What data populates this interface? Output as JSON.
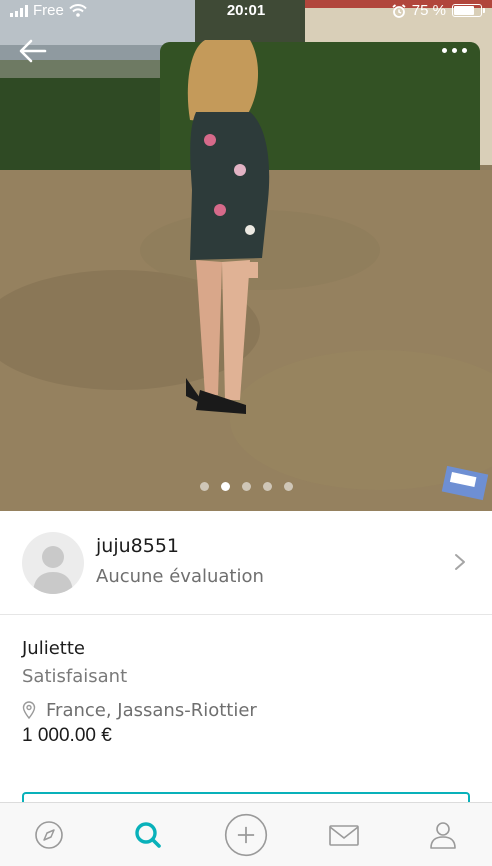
{
  "status_bar": {
    "carrier": "Free",
    "time": "20:01",
    "battery_text": "75 %",
    "battery_level": 0.75
  },
  "photo": {
    "current_index": 2,
    "count": 5
  },
  "seller": {
    "username": "juju8551",
    "rating_text": "Aucune évaluation"
  },
  "item": {
    "title": "Juliette",
    "condition": "Satisfaisant",
    "location": "France, Jassans-Riottier",
    "price": "1 000.00 €"
  },
  "tabs": [
    {
      "icon": "compass-icon"
    },
    {
      "icon": "search-icon",
      "active": true
    },
    {
      "icon": "plus-circle-icon"
    },
    {
      "icon": "mail-icon"
    },
    {
      "icon": "profile-icon"
    }
  ],
  "colors": {
    "accent": "#09b1ba",
    "icon_gray": "#9a9a9a"
  }
}
